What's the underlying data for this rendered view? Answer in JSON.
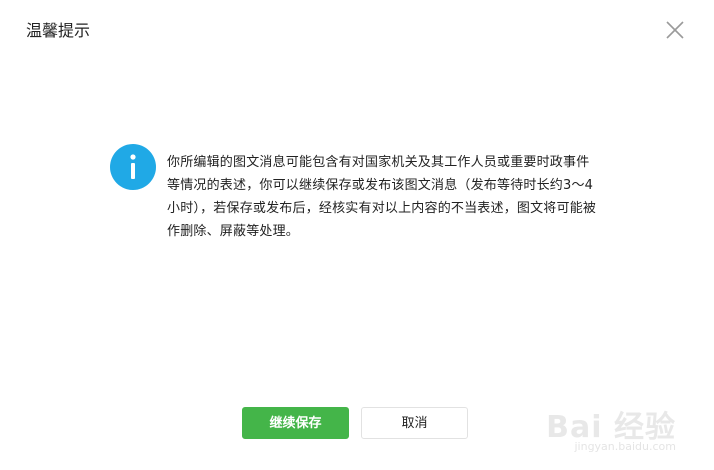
{
  "dialog": {
    "title": "温馨提示",
    "message": "你所编辑的图文消息可能包含有对国家机关及其工作人员或重要时政事件等情况的表述，你可以继续保存或发布该图文消息（发布等待时长约3～4小时），若保存或发布后，经核实有对以上内容的不当表述，图文将可能被作删除、屏蔽等处理。",
    "primary_button_label": "继续保存",
    "cancel_button_label": "取消"
  },
  "icons": {
    "close": "close-icon",
    "info": "info-icon"
  },
  "watermark": {
    "logo_text": "Bai 经验",
    "url": "jingyan.baidu.com"
  },
  "colors": {
    "primary": "#44b549",
    "info": "#20a9e6",
    "close_icon": "#9a9a9a",
    "text": "#222222"
  }
}
